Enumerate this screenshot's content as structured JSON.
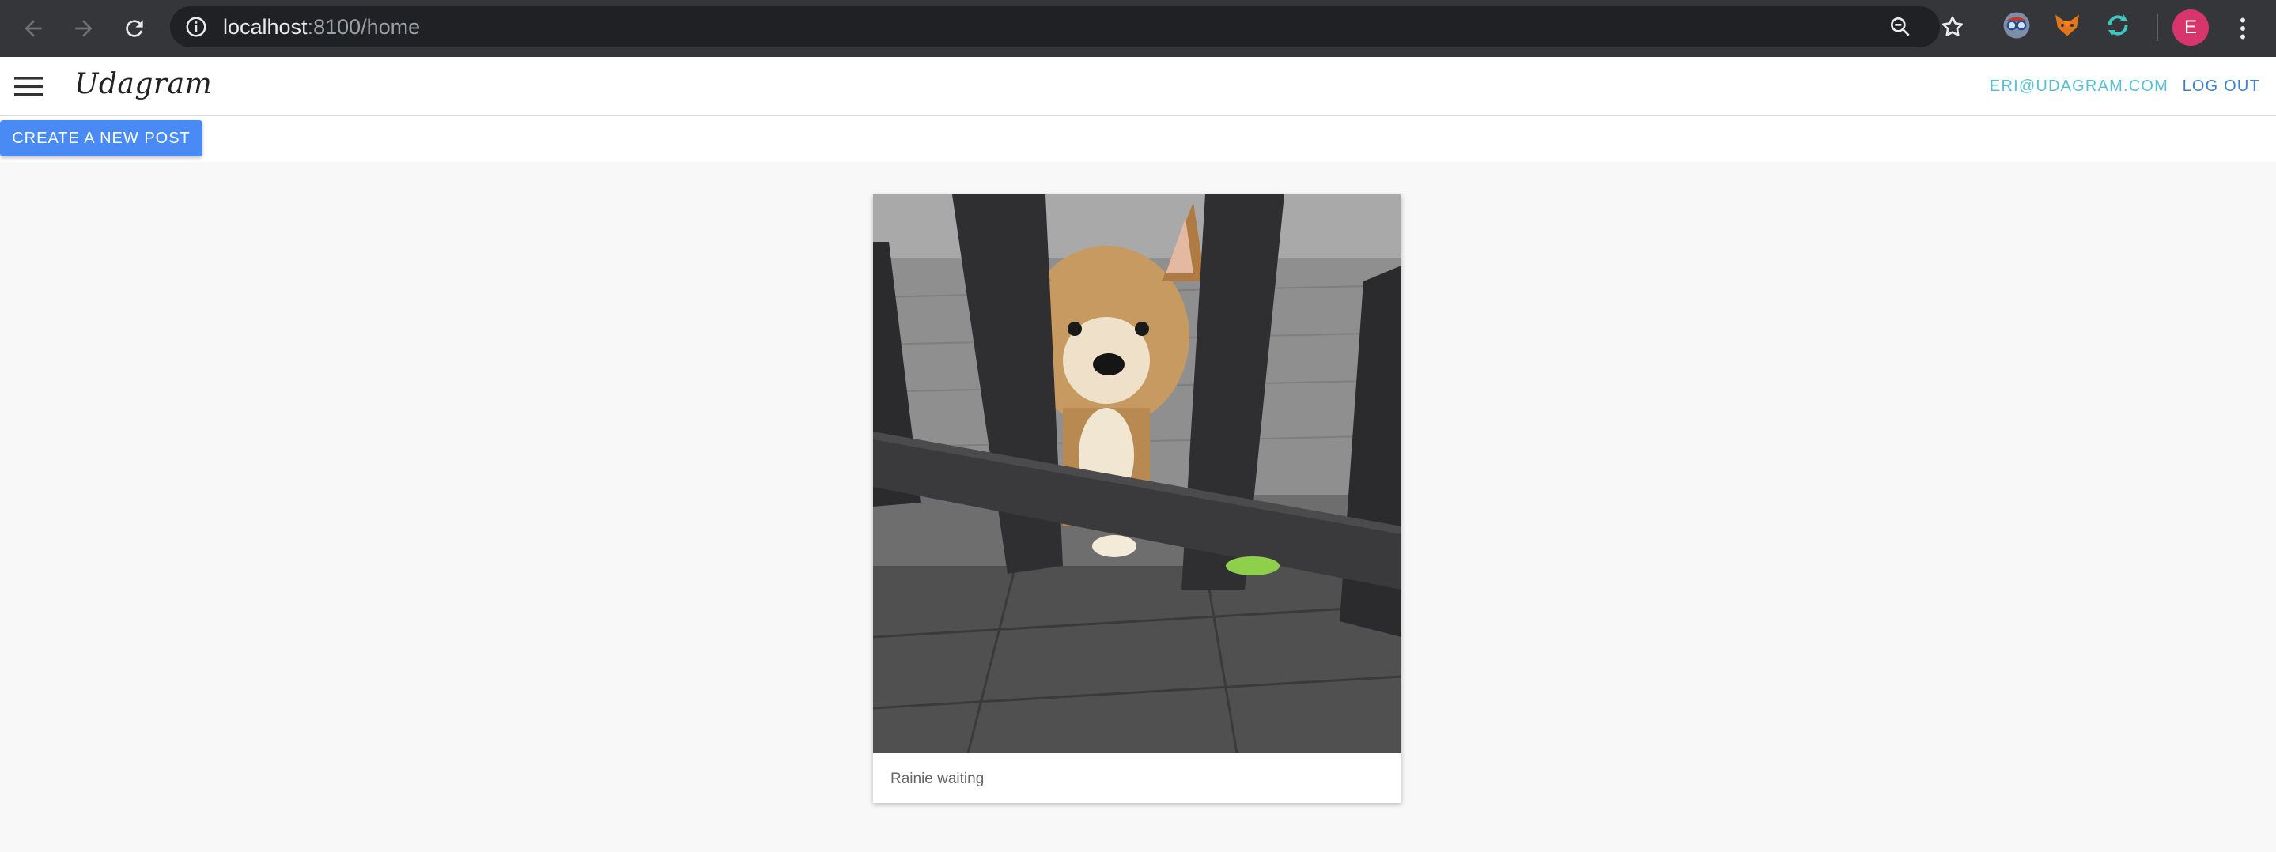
{
  "browser": {
    "url_host": "localhost",
    "url_path": ":8100/home",
    "profile_initial": "E",
    "extensions": [
      "glasses-extension-icon",
      "fox-extension-icon",
      "sync-extension-icon"
    ]
  },
  "header": {
    "brand": "Udagram",
    "user_email": "ERI@UDAGRAM.COM",
    "logout_label": "LOG OUT"
  },
  "toolbar": {
    "create_label": "CREATE A NEW POST"
  },
  "feed": {
    "items": [
      {
        "caption": "Rainie waiting",
        "image": "dog-behind-fence-photo"
      }
    ]
  },
  "colors": {
    "primary": "#4a8af4",
    "email": "#56c1d6",
    "logout": "#3b82d6",
    "avatar": "#d7356b"
  }
}
